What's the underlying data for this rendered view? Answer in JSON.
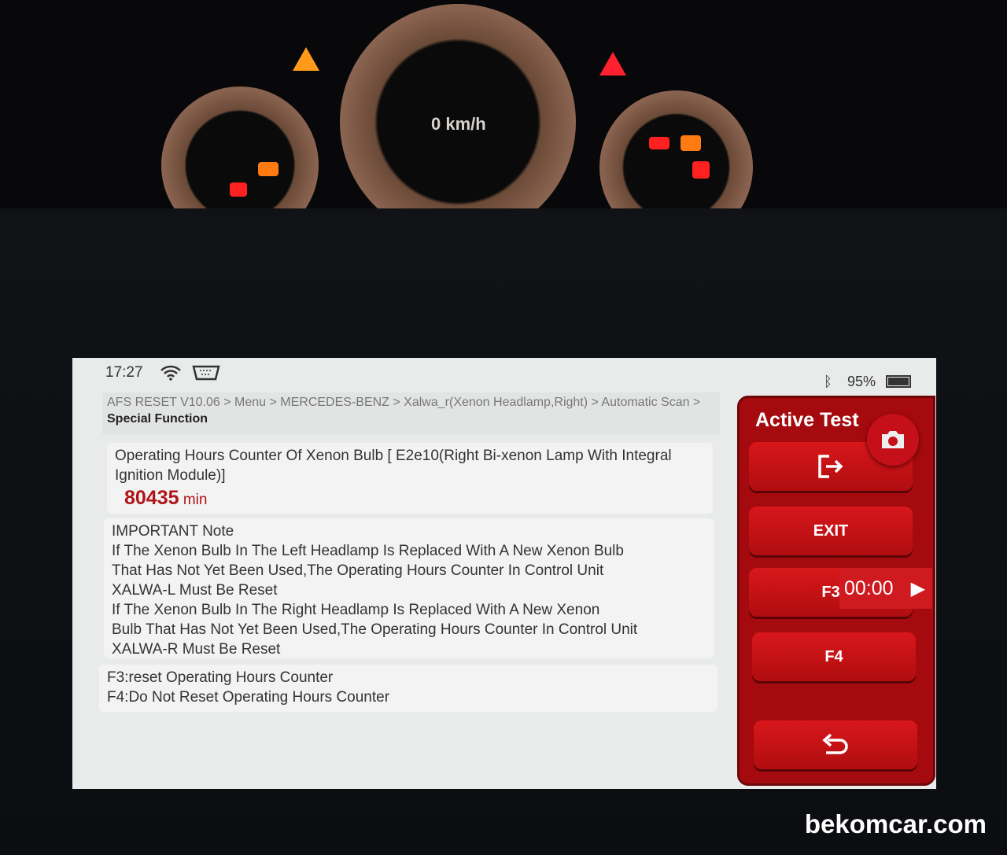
{
  "dashboard": {
    "speed_readout": "0 km/h"
  },
  "status_bar": {
    "time": "17:27",
    "battery": "95%",
    "icons": [
      "wifi-icon",
      "vci-connector-icon",
      "bluetooth-icon",
      "battery-icon"
    ]
  },
  "breadcrumb": {
    "path": "AFS RESET V10.06 > Menu > MERCEDES-BENZ > Xalwa_r(Xenon Headlamp,Right) > Automatic Scan > ",
    "current": "Special Function"
  },
  "counter": {
    "label": "Operating Hours Counter Of Xenon Bulb [ E2e10(Right Bi-xenon Lamp With Integral Ignition Module)]",
    "value": "80435",
    "unit": "min"
  },
  "note": {
    "title": "IMPORTANT Note",
    "lines": [
      "If The Xenon Bulb In The Left Headlamp  Is Replaced With A New Xenon Bulb",
      "That Has Not Yet Been Used,The Operating Hours Counter In Control Unit",
      "XALWA-L Must Be Reset",
      "If The Xenon Bulb In The Right Headlamp Is Replaced With A New Xenon",
      "Bulb That Has Not Yet Been Used,The Operating Hours Counter In Control Unit",
      "XALWA-R Must Be Reset"
    ]
  },
  "options": {
    "lines": [
      "F3:reset Operating Hours Counter",
      "F4:Do Not Reset Operating Hours Counter"
    ]
  },
  "side_panel": {
    "title": "Active Test",
    "buttons": {
      "exit": "EXIT",
      "f3": "F3",
      "f4": "F4"
    },
    "timer": "00:00"
  },
  "colors": {
    "accent": "#b00d10",
    "value": "#b0141a"
  },
  "watermark": "bekomcar.com"
}
